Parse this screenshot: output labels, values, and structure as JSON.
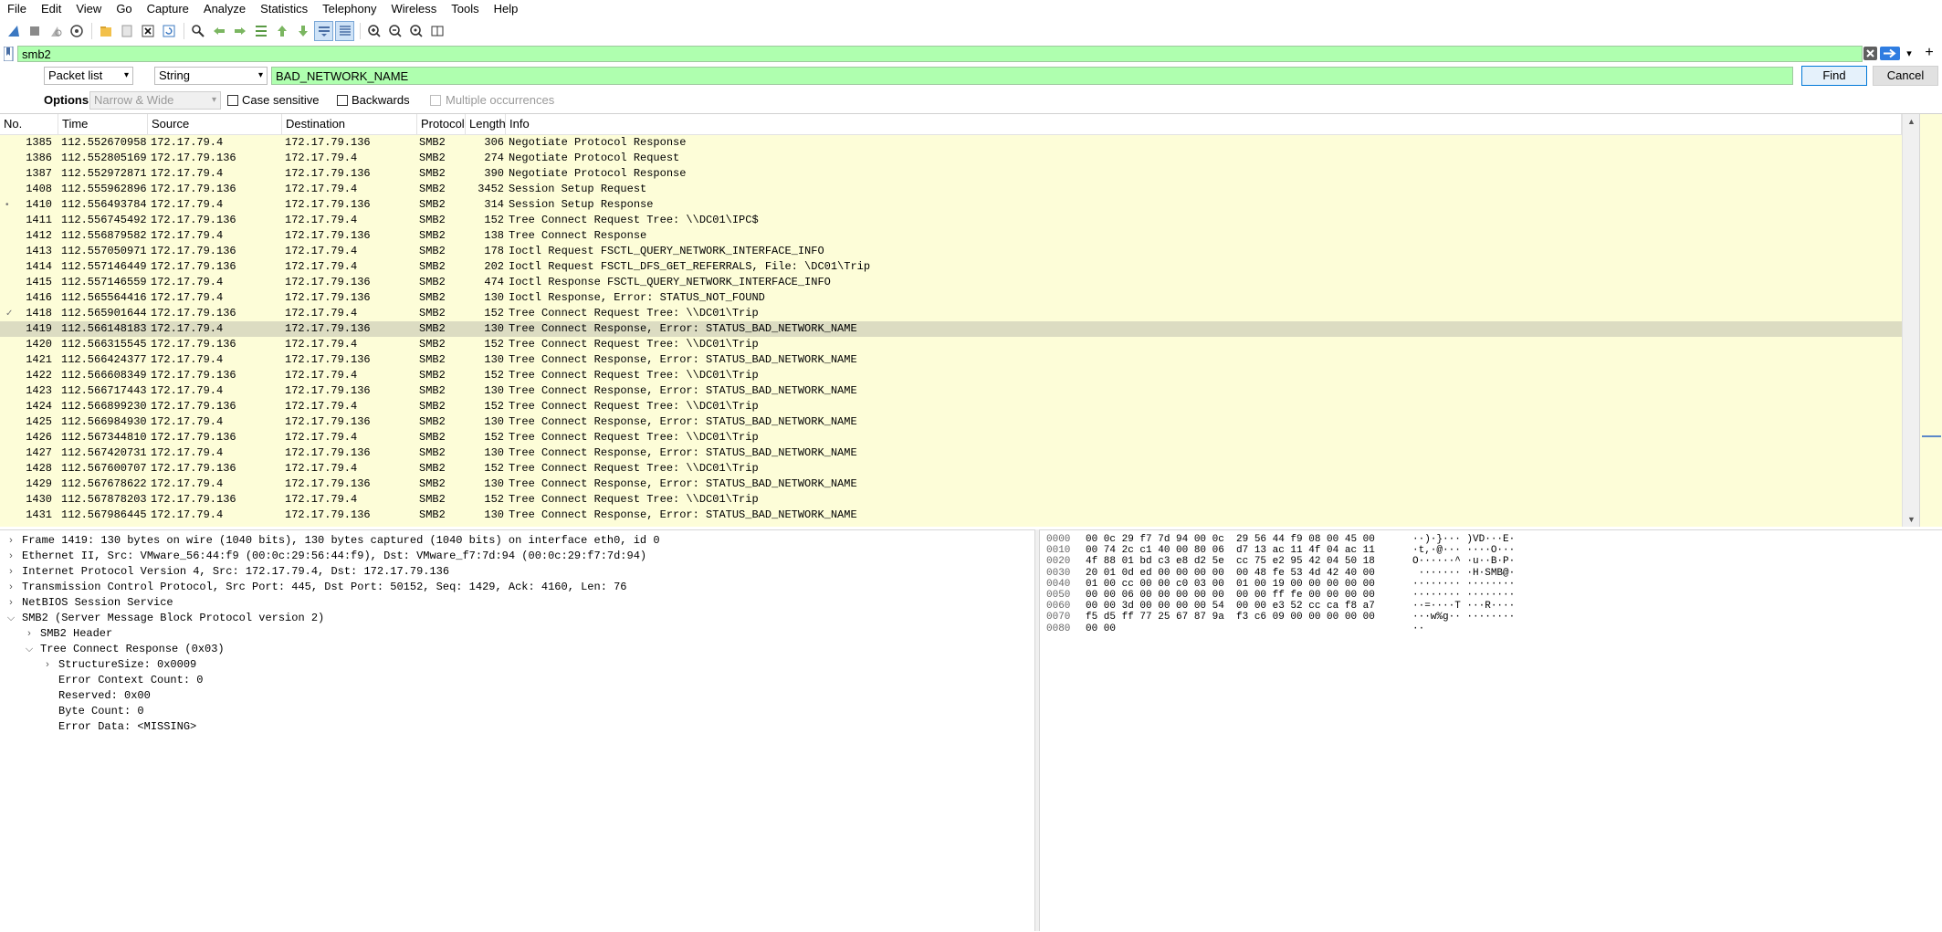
{
  "menu": [
    "File",
    "Edit",
    "View",
    "Go",
    "Capture",
    "Analyze",
    "Statistics",
    "Telephony",
    "Wireless",
    "Tools",
    "Help"
  ],
  "toolbar": {
    "icons": [
      "shark-fin-start-icon",
      "stop-capture-icon",
      "restart-capture-icon",
      "capture-options-icon",
      "open-file-icon",
      "save-file-icon",
      "close-file-icon",
      "reload-file-icon",
      "find-packet-icon",
      "go-back-icon",
      "go-forward-icon",
      "go-to-packet-icon",
      "go-first-icon",
      "go-last-icon",
      "auto-scroll-icon",
      "colorize-icon",
      "zoom-in-icon",
      "zoom-out-icon",
      "zoom-reset-icon",
      "resize-columns-icon"
    ]
  },
  "filter": {
    "value": "smb2"
  },
  "find": {
    "scope": "Packet list",
    "type": "String",
    "value": "BAD_NETWORK_NAME",
    "find_label": "Find",
    "cancel_label": "Cancel"
  },
  "options": {
    "label": "Options:",
    "charwidth": "Narrow & Wide",
    "case_sensitive": "Case sensitive",
    "backwards": "Backwards",
    "multiple": "Multiple occurrences"
  },
  "packet_list": {
    "columns": [
      "No.",
      "Time",
      "Source",
      "Destination",
      "Protocol",
      "Length",
      "Info"
    ],
    "rows": [
      [
        "1385",
        "112.552670958",
        "172.17.79.4",
        "172.17.79.136",
        "SMB2",
        "306",
        "Negotiate Protocol Response"
      ],
      [
        "1386",
        "112.552805169",
        "172.17.79.136",
        "172.17.79.4",
        "SMB2",
        "274",
        "Negotiate Protocol Request"
      ],
      [
        "1387",
        "112.552972871",
        "172.17.79.4",
        "172.17.79.136",
        "SMB2",
        "390",
        "Negotiate Protocol Response"
      ],
      [
        "1408",
        "112.555962896",
        "172.17.79.136",
        "172.17.79.4",
        "SMB2",
        "3452",
        "Session Setup Request"
      ],
      [
        "1410",
        "112.556493784",
        "172.17.79.4",
        "172.17.79.136",
        "SMB2",
        "314",
        "Session Setup Response"
      ],
      [
        "1411",
        "112.556745492",
        "172.17.79.136",
        "172.17.79.4",
        "SMB2",
        "152",
        "Tree Connect Request Tree: \\\\DC01\\IPC$"
      ],
      [
        "1412",
        "112.556879582",
        "172.17.79.4",
        "172.17.79.136",
        "SMB2",
        "138",
        "Tree Connect Response"
      ],
      [
        "1413",
        "112.557050971",
        "172.17.79.136",
        "172.17.79.4",
        "SMB2",
        "178",
        "Ioctl Request FSCTL_QUERY_NETWORK_INTERFACE_INFO"
      ],
      [
        "1414",
        "112.557146449",
        "172.17.79.136",
        "172.17.79.4",
        "SMB2",
        "202",
        "Ioctl Request FSCTL_DFS_GET_REFERRALS, File: \\DC01\\Trip"
      ],
      [
        "1415",
        "112.557146559",
        "172.17.79.4",
        "172.17.79.136",
        "SMB2",
        "474",
        "Ioctl Response FSCTL_QUERY_NETWORK_INTERFACE_INFO"
      ],
      [
        "1416",
        "112.565564416",
        "172.17.79.4",
        "172.17.79.136",
        "SMB2",
        "130",
        "Ioctl Response, Error: STATUS_NOT_FOUND"
      ],
      [
        "1418",
        "112.565901644",
        "172.17.79.136",
        "172.17.79.4",
        "SMB2",
        "152",
        "Tree Connect Request Tree: \\\\DC01\\Trip"
      ],
      [
        "1419",
        "112.566148183",
        "172.17.79.4",
        "172.17.79.136",
        "SMB2",
        "130",
        "Tree Connect Response, Error: STATUS_BAD_NETWORK_NAME"
      ],
      [
        "1420",
        "112.566315545",
        "172.17.79.136",
        "172.17.79.4",
        "SMB2",
        "152",
        "Tree Connect Request Tree: \\\\DC01\\Trip"
      ],
      [
        "1421",
        "112.566424377",
        "172.17.79.4",
        "172.17.79.136",
        "SMB2",
        "130",
        "Tree Connect Response, Error: STATUS_BAD_NETWORK_NAME"
      ],
      [
        "1422",
        "112.566608349",
        "172.17.79.136",
        "172.17.79.4",
        "SMB2",
        "152",
        "Tree Connect Request Tree: \\\\DC01\\Trip"
      ],
      [
        "1423",
        "112.566717443",
        "172.17.79.4",
        "172.17.79.136",
        "SMB2",
        "130",
        "Tree Connect Response, Error: STATUS_BAD_NETWORK_NAME"
      ],
      [
        "1424",
        "112.566899230",
        "172.17.79.136",
        "172.17.79.4",
        "SMB2",
        "152",
        "Tree Connect Request Tree: \\\\DC01\\Trip"
      ],
      [
        "1425",
        "112.566984930",
        "172.17.79.4",
        "172.17.79.136",
        "SMB2",
        "130",
        "Tree Connect Response, Error: STATUS_BAD_NETWORK_NAME"
      ],
      [
        "1426",
        "112.567344810",
        "172.17.79.136",
        "172.17.79.4",
        "SMB2",
        "152",
        "Tree Connect Request Tree: \\\\DC01\\Trip"
      ],
      [
        "1427",
        "112.567420731",
        "172.17.79.4",
        "172.17.79.136",
        "SMB2",
        "130",
        "Tree Connect Response, Error: STATUS_BAD_NETWORK_NAME"
      ],
      [
        "1428",
        "112.567600707",
        "172.17.79.136",
        "172.17.79.4",
        "SMB2",
        "152",
        "Tree Connect Request Tree: \\\\DC01\\Trip"
      ],
      [
        "1429",
        "112.567678622",
        "172.17.79.4",
        "172.17.79.136",
        "SMB2",
        "130",
        "Tree Connect Response, Error: STATUS_BAD_NETWORK_NAME"
      ],
      [
        "1430",
        "112.567878203",
        "172.17.79.136",
        "172.17.79.4",
        "SMB2",
        "152",
        "Tree Connect Request Tree: \\\\DC01\\Trip"
      ],
      [
        "1431",
        "112.567986445",
        "172.17.79.4",
        "172.17.79.136",
        "SMB2",
        "130",
        "Tree Connect Response, Error: STATUS_BAD_NETWORK_NAME"
      ]
    ],
    "selected_index": 12,
    "row_bg": "#fdfdd8",
    "selected_bg": "#dcdcc2"
  },
  "details": [
    {
      "depth": 0,
      "twisty": "closed",
      "text": "Frame 1419: 130 bytes on wire (1040 bits), 130 bytes captured (1040 bits) on interface eth0, id 0"
    },
    {
      "depth": 0,
      "twisty": "closed",
      "text": "Ethernet II, Src: VMware_56:44:f9 (00:0c:29:56:44:f9), Dst: VMware_f7:7d:94 (00:0c:29:f7:7d:94)"
    },
    {
      "depth": 0,
      "twisty": "closed",
      "text": "Internet Protocol Version 4, Src: 172.17.79.4, Dst: 172.17.79.136"
    },
    {
      "depth": 0,
      "twisty": "closed",
      "text": "Transmission Control Protocol, Src Port: 445, Dst Port: 50152, Seq: 1429, Ack: 4160, Len: 76"
    },
    {
      "depth": 0,
      "twisty": "closed",
      "text": "NetBIOS Session Service"
    },
    {
      "depth": 0,
      "twisty": "open",
      "text": "SMB2 (Server Message Block Protocol version 2)"
    },
    {
      "depth": 1,
      "twisty": "closed",
      "text": "SMB2 Header"
    },
    {
      "depth": 1,
      "twisty": "open",
      "text": "Tree Connect Response (0x03)"
    },
    {
      "depth": 2,
      "twisty": "closed",
      "text": "StructureSize: 0x0009"
    },
    {
      "depth": 2,
      "twisty": "none",
      "text": "Error Context Count: 0"
    },
    {
      "depth": 2,
      "twisty": "none",
      "text": "Reserved: 0x00"
    },
    {
      "depth": 2,
      "twisty": "none",
      "text": "Byte Count: 0"
    },
    {
      "depth": 2,
      "twisty": "none",
      "text": "Error Data: <MISSING>"
    }
  ],
  "bytes": [
    {
      "offset": "0000",
      "hex": "00 0c 29 f7 7d 94 00 0c  29 56 44 f9 08 00 45 00",
      "ascii": "··)·}··· )VD···E·"
    },
    {
      "offset": "0010",
      "hex": "00 74 2c c1 40 00 80 06  d7 13 ac 11 4f 04 ac 11",
      "ascii": "·t,·@··· ····O···"
    },
    {
      "offset": "0020",
      "hex": "4f 88 01 bd c3 e8 d2 5e  cc 75 e2 95 42 04 50 18",
      "ascii": "O······^ ·u··B·P·"
    },
    {
      "offset": "0030",
      "hex": "20 01 0d ed 00 00 00 00  00 48 fe 53 4d 42 40 00",
      "ascii": " ······· ·H·SMB@·"
    },
    {
      "offset": "0040",
      "hex": "01 00 cc 00 00 c0 03 00  01 00 19 00 00 00 00 00",
      "ascii": "········ ········"
    },
    {
      "offset": "0050",
      "hex": "00 00 06 00 00 00 00 00  00 00 ff fe 00 00 00 00",
      "ascii": "········ ········"
    },
    {
      "offset": "0060",
      "hex": "00 00 3d 00 00 00 00 54  00 00 e3 52 cc ca f8 a7",
      "ascii": "··=····T ···R····"
    },
    {
      "offset": "0070",
      "hex": "f5 d5 ff 77 25 67 87 9a  f3 c6 09 00 00 00 00 00",
      "ascii": "···w%g·· ········"
    },
    {
      "offset": "0080",
      "hex": "00 00",
      "ascii": "··"
    }
  ]
}
